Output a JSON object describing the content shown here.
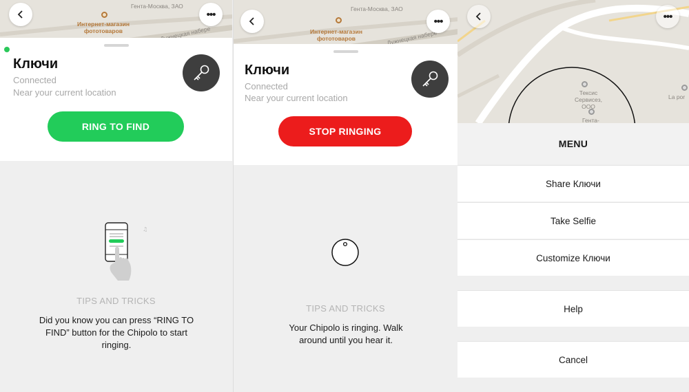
{
  "screen1": {
    "map_labels": {
      "store": "Интернет-магазин фототоваров",
      "genta": "Гента-Москва, ЗАО",
      "street": "Лужнецкая набере"
    },
    "item_name": "Ключи",
    "status": "Connected",
    "location": "Near your current location",
    "action_button": "RING TO FIND",
    "tips_heading": "TIPS AND TRICKS",
    "tips_text": "Did you know you can press “RING TO FIND” button for the Chipolo to start ringing."
  },
  "screen2": {
    "map_labels": {
      "store": "Интернет-магазин фототоваров",
      "genta": "Гента-Москва, ЗАО",
      "street": "Лужнецкая набере"
    },
    "item_name": "Ключи",
    "status": "Connected",
    "location": "Near your current location",
    "action_button": "STOP RINGING",
    "tips_heading": "TIPS AND TRICKS",
    "tips_text": "Your Chipolo is ringing. Walk around until you hear it."
  },
  "screen3": {
    "map_labels": {
      "texsis": "Тексис Сервисез, ООО",
      "genta": "Гента-",
      "lapor": "La por"
    },
    "menu_title": "MENU",
    "items": [
      "Share Ключи",
      "Take Selfie",
      "Customize Ключи"
    ],
    "help": "Help",
    "cancel": "Cancel"
  },
  "colors": {
    "ring_green": "#22cc5a",
    "stop_red": "#ec1c1c",
    "status_dot": "#2bc85a",
    "key_bg": "#3e3e3e"
  },
  "icons": {
    "back": "chevron-left-icon",
    "more": "more-dots-icon",
    "key": "key-icon",
    "phone_tip": "phone-hand-icon",
    "chipolo": "chipolo-ring-icon"
  }
}
